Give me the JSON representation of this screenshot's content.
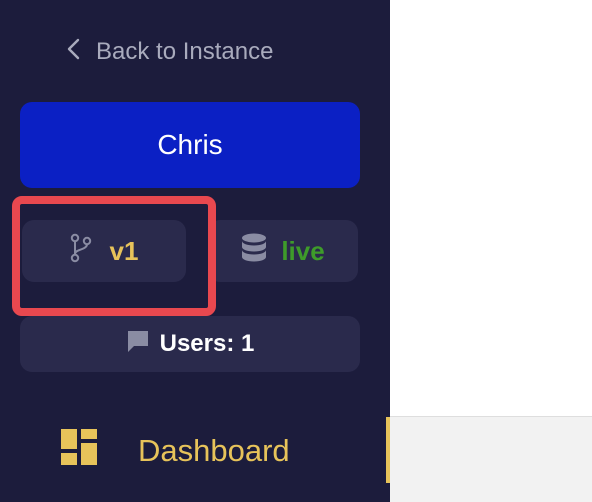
{
  "sidebar": {
    "back_label": "Back to Instance",
    "user_label": "Chris",
    "branch": {
      "icon": "git-branch-icon",
      "label": "v1"
    },
    "environment": {
      "icon": "database-icon",
      "label": "live"
    },
    "users": {
      "icon": "chat-icon",
      "label": "Users: 1"
    },
    "nav": [
      {
        "icon": "dashboard-icon",
        "label": "Dashboard",
        "active": true
      }
    ]
  },
  "colors": {
    "sidebar_bg": "#1c1c3c",
    "user_button_bg": "#0b20c4",
    "pill_bg": "#2a2a4c",
    "branch_text": "#e7c35a",
    "live_text": "#3e9b2a",
    "highlight": "#e8484f",
    "accent": "#e7c35a"
  }
}
